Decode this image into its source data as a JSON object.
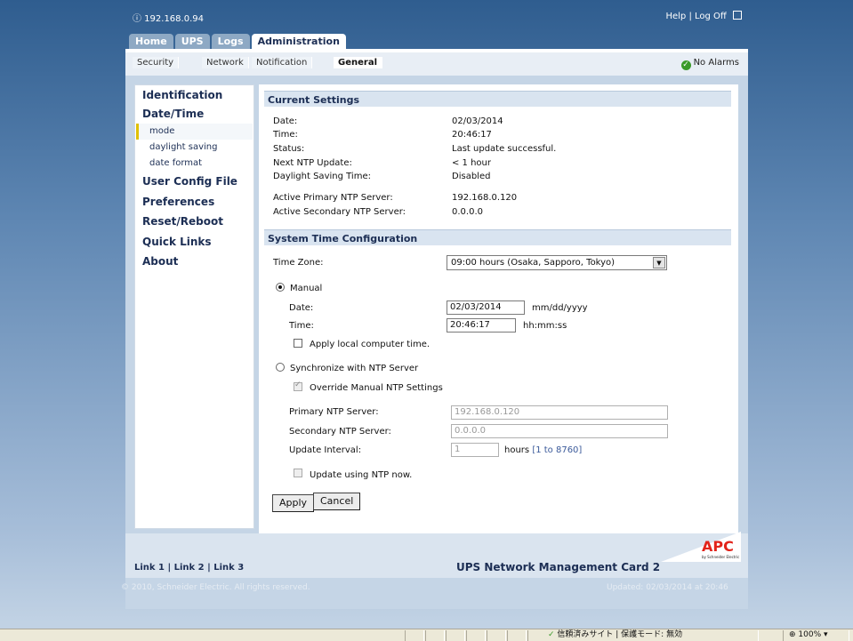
{
  "top": {
    "ip": "ⓘ 192.168.0.94",
    "help": "Help",
    "sep": "|",
    "logoff": "Log Off"
  },
  "tabs": [
    "Home",
    "UPS",
    "Logs",
    "Administration"
  ],
  "subtabs": [
    "Security",
    "Network",
    "Notification",
    "General"
  ],
  "alarms": "No Alarms",
  "nav": {
    "identification": "Identification",
    "datetime": "Date/Time",
    "mode": "mode",
    "daylight": "daylight saving",
    "dateformat": "date format",
    "userconfig": "User Config File",
    "preferences": "Preferences",
    "reset": "Reset/Reboot",
    "quicklinks": "Quick Links",
    "about": "About"
  },
  "current": {
    "header": "Current Settings",
    "date_label": "Date:",
    "date": "02/03/2014",
    "time_label": "Time:",
    "time": "20:46:17",
    "status_label": "Status:",
    "status": "Last update successful.",
    "next_label": "Next NTP Update:",
    "next": "< 1 hour",
    "dst_label": "Daylight Saving Time:",
    "dst": "Disabled",
    "primary_label": "Active Primary NTP Server:",
    "primary": "192.168.0.120",
    "secondary_label": "Active Secondary NTP Server:",
    "secondary": "0.0.0.0"
  },
  "config": {
    "header": "System Time Configuration",
    "tz_label": "Time Zone:",
    "tz_value": "09:00 hours (Osaka, Sapporo, Tokyo)",
    "manual": "Manual",
    "date_label": "Date:",
    "date_value": "02/03/2014",
    "date_fmt": "mm/dd/yyyy",
    "time_label": "Time:",
    "time_value": "20:46:17",
    "time_fmt": "hh:mm:ss",
    "apply_local": "Apply local computer time.",
    "sync": "Synchronize with NTP Server",
    "override": "Override Manual NTP Settings",
    "primary_label": "Primary NTP Server:",
    "primary_value": "192.168.0.120",
    "secondary_label": "Secondary NTP Server:",
    "secondary_value": "0.0.0.0",
    "interval_label": "Update Interval:",
    "interval_value": "1",
    "interval_unit": "hours",
    "interval_range": "[1 to 8760]",
    "update_now": "Update using NTP now.",
    "apply": "Apply",
    "cancel": "Cancel"
  },
  "footer": {
    "links": "Link 1 | Link 2 | Link 3",
    "card": "UPS Network Management Card 2",
    "brand": "APC",
    "brand_sub": "by Schneider Electric",
    "copyright": "© 2010, Schneider Electric. All rights reserved.",
    "updated": "Updated: 02/03/2014 at 20:46"
  },
  "statusbar": {
    "zone": "信頼済みサイト | 保護モード: 無効",
    "zoom": "100%"
  }
}
